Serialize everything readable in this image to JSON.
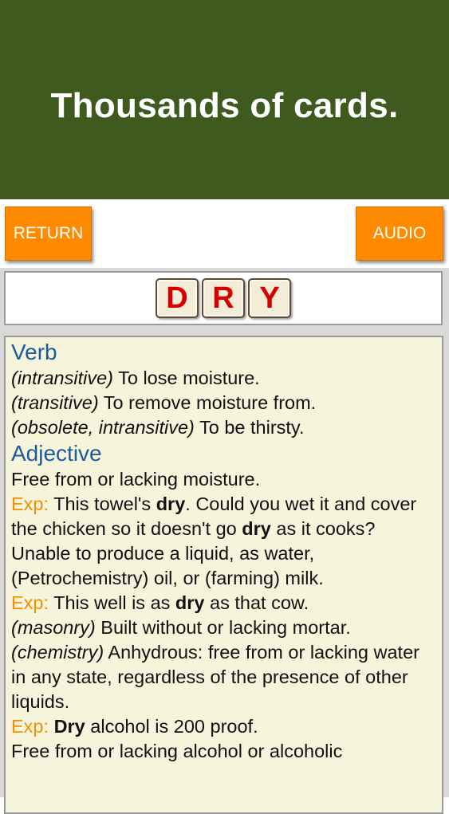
{
  "banner": {
    "title": "Thousands of cards."
  },
  "toolbar": {
    "return_label": "RETURN",
    "audio_label": "AUDIO"
  },
  "word": {
    "letters": [
      "D",
      "R",
      "Y"
    ]
  },
  "definitions": {
    "verb": {
      "heading": "Verb",
      "entries": [
        {
          "label": "(intransitive)",
          "text": " To lose moisture."
        },
        {
          "label": "(transitive)",
          "text": " To remove moisture from."
        },
        {
          "label": "(obsolete, intransitive)",
          "text": " To be thirsty."
        }
      ]
    },
    "adjective": {
      "heading": "Adjective",
      "def1": "Free from or lacking moisture.",
      "exp_label": "Exp:",
      "exp1_a": " This towel's ",
      "exp1_b": "dry",
      "exp1_c": ". Could you wet it and cover the chicken so it doesn't go ",
      "exp1_d": "dry",
      "exp1_e": " as it cooks?",
      "def2": "Unable to produce a liquid, as water, (Petrochemistry) oil, or (farming) milk.",
      "exp2_a": " This well is as ",
      "exp2_b": "dry",
      "exp2_c": " as that cow.",
      "def3_label": "(masonry)",
      "def3_text": " Built without or lacking mortar.",
      "def4_label": "(chemistry)",
      "def4_text": " Anhydrous: free from or lacking water in any state, regardless of the presence of other liquids.",
      "exp3_a": " ",
      "exp3_b": "Dry",
      "exp3_c": " alcohol is 200 proof.",
      "def5": "Free from or lacking alcohol or alcoholic"
    }
  },
  "colors": {
    "banner_bg": "#3f5a1f",
    "button_bg": "#ff8a00",
    "tile_letter": "#d40000",
    "heading": "#1c5b9a",
    "exp_label": "#f39000",
    "panel_bg": "#f7f4dc"
  }
}
